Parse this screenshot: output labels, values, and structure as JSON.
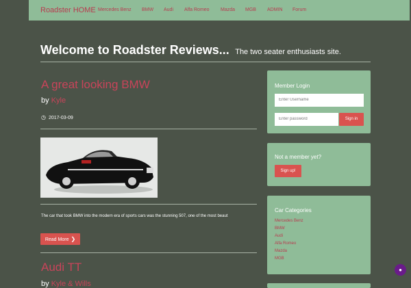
{
  "nav": {
    "brand": "Roadster HOME",
    "items": [
      "Mercedes Benz",
      "BMW",
      "Audi",
      "Alfa Romeo",
      "Mazda",
      "MGB",
      "ADMIN",
      "Forum"
    ]
  },
  "welcome": {
    "title": "Welcome to Roadster Reviews...",
    "tagline": "The two seater enthusiasts site."
  },
  "posts": [
    {
      "title": "A great looking BMW",
      "by": "by",
      "author": "Kyle",
      "date": "2017-03-09",
      "excerpt": "The car that took BMW into the modern era of sports cars was the stunning 507, one of the most beaut",
      "read_more": "Read More"
    },
    {
      "title": "Audi TT",
      "by": "by",
      "author": "Kyle & Wills"
    }
  ],
  "sidebar": {
    "login": {
      "title": "Member Login",
      "username_placeholder": "Enter Username",
      "password_placeholder": "Enter password",
      "signin": "Sign in"
    },
    "signup": {
      "title": "Not a member yet?",
      "button": "Sign up!"
    },
    "categories": {
      "title": "Car Categories",
      "items": [
        "Mercedes Benz",
        "BMW",
        "Audi",
        "Alfa Romeo",
        "Mazda",
        "MGB"
      ]
    }
  },
  "icons": {
    "date": "clock-icon",
    "read_more": "chevron-right-icon",
    "float": "chat-icon"
  },
  "colors": {
    "background": "#4b5348",
    "panel": "#8fbc98",
    "accent": "#c9445a",
    "button": "#d9534f"
  }
}
